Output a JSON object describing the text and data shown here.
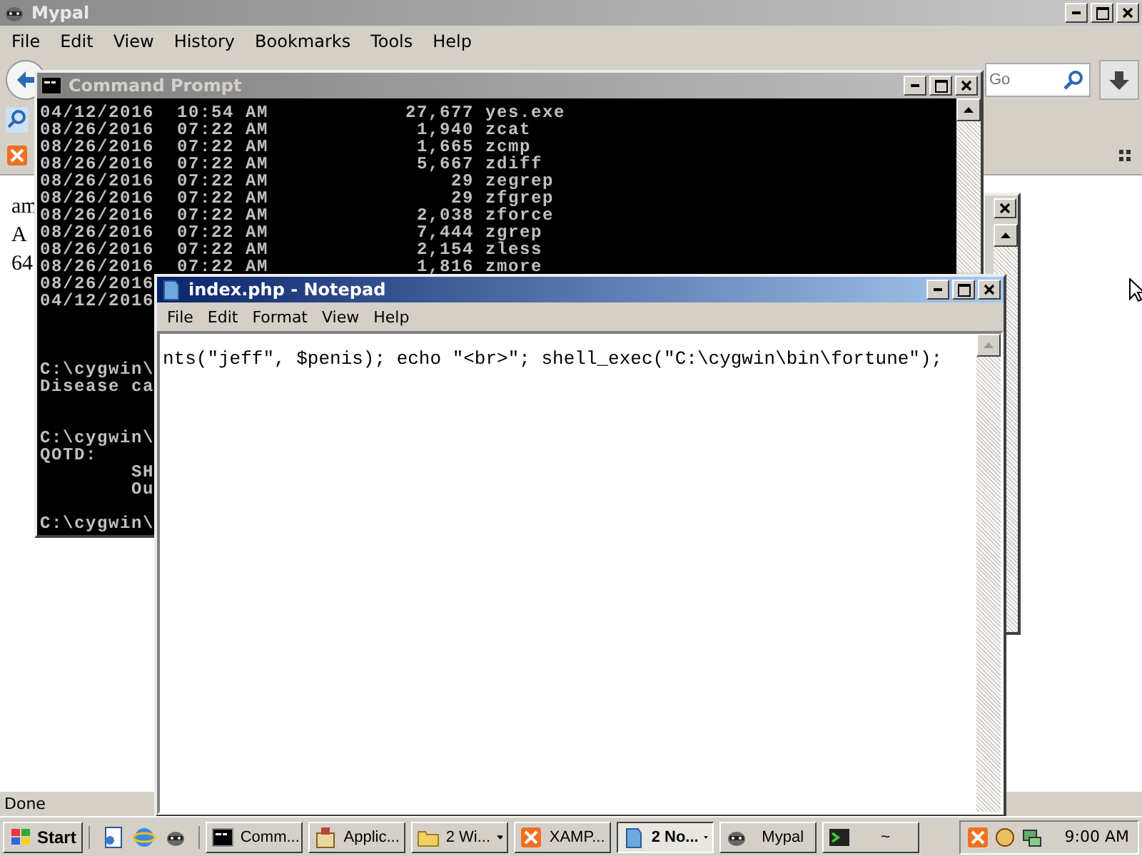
{
  "browser": {
    "title": "Mypal",
    "menu": [
      "File",
      "Edit",
      "View",
      "History",
      "Bookmarks",
      "Tools",
      "Help"
    ],
    "search": {
      "placeholder": "Go"
    },
    "page_text": [
      "am",
      "A",
      "64"
    ],
    "status_bar": "Done"
  },
  "console_window": {
    "title": "Command Prompt",
    "output": "04/12/2016  10:54 AM            27,677 yes.exe\n08/26/2016  07:22 AM             1,940 zcat\n08/26/2016  07:22 AM             1,665 zcmp\n08/26/2016  07:22 AM             5,667 zdiff\n08/26/2016  07:22 AM                29 zegrep\n08/26/2016  07:22 AM                29 zfgrep\n08/26/2016  07:22 AM             2,038 zforce\n08/26/2016  07:22 AM             7,444 zgrep\n08/26/2016  07:22 AM             2,154 zless\n08/26/2016  07:22 AM             1,816 zmore\n08/26/2016\n04/12/2016\n\n\n\nC:\\cygwin\\\nDisease ca\n\n\nC:\\cygwin\\\nQOTD:\n        SH\n        Ou\n\nC:\\cygwin\\"
  },
  "notepad": {
    "title": "index.php - Notepad",
    "menu": [
      "File",
      "Edit",
      "Format",
      "View",
      "Help"
    ],
    "text": "nts(\"jeff\", $penis); echo \"<br>\"; shell_exec(\"C:\\cygwin\\bin\\fortune\");"
  },
  "taskbar": {
    "start": "Start",
    "buttons": [
      {
        "label": "Comm...",
        "kind": "console",
        "grouped": false,
        "selected": false
      },
      {
        "label": "Applic...",
        "kind": "apps",
        "grouped": false,
        "selected": false
      },
      {
        "label": "2 Wi...",
        "kind": "folder",
        "grouped": true,
        "selected": false
      },
      {
        "label": "XAMP...",
        "kind": "xampp",
        "grouped": false,
        "selected": false
      },
      {
        "label": "2 No...",
        "kind": "notepad",
        "grouped": true,
        "selected": true
      },
      {
        "label": "Mypal",
        "kind": "raccoon",
        "grouped": false,
        "selected": false
      },
      {
        "label": "~",
        "kind": "terminal",
        "grouped": false,
        "selected": false
      }
    ],
    "clock": "9:00 AM"
  }
}
